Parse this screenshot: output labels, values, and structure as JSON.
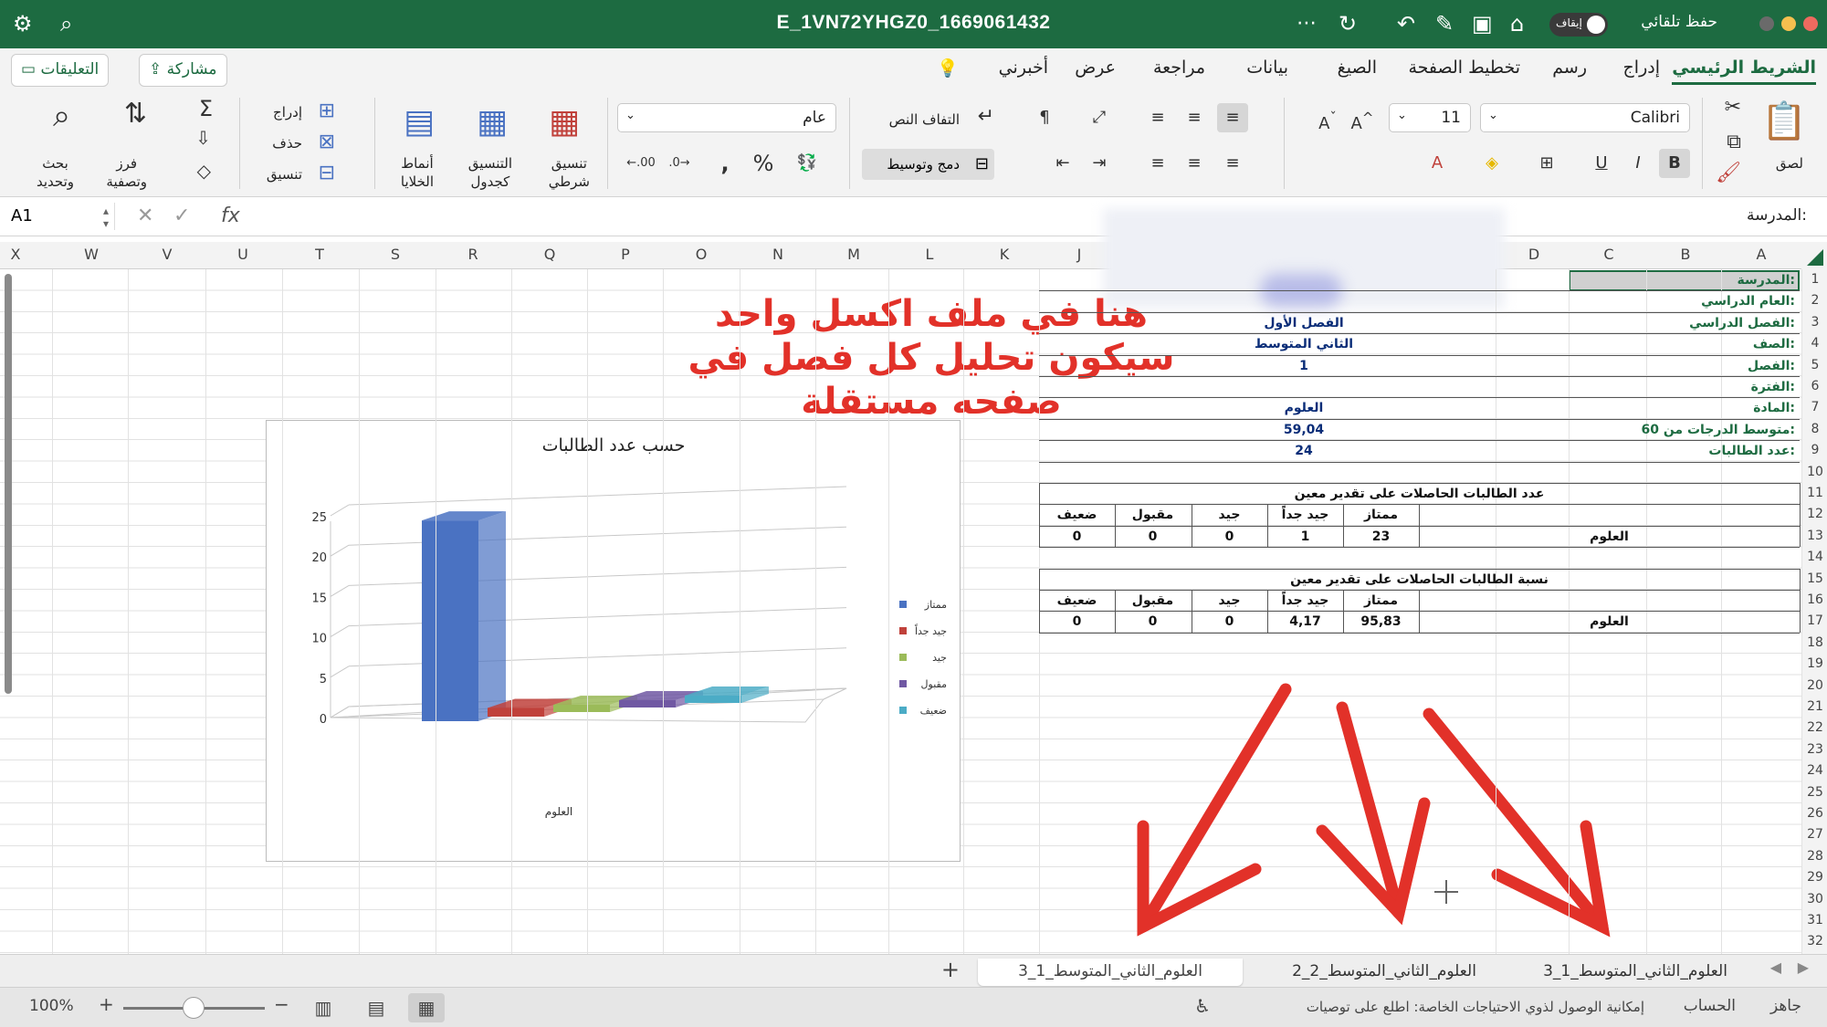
{
  "window": {
    "title": "E_1VN72YHGZ0_1669061432",
    "autosave_label": "حفظ تلقائي",
    "autosave_state": "إيقاف"
  },
  "ribbon_tabs": [
    "الشريط الرئيسي",
    "إدراج",
    "رسم",
    "تخطيط الصفحة",
    "الصيغ",
    "بيانات",
    "مراجعة",
    "عرض",
    "أخبرني"
  ],
  "share_label": "مشاركة",
  "comments_label": "التعليقات",
  "ribbon": {
    "paste": "لصق",
    "font_name": "Calibri",
    "font_size": "11",
    "wrap_text": "التفاف النص",
    "merge_center": "دمج وتوسيط",
    "number_format": "عام",
    "conditional_formatting": [
      "تنسيق",
      "شرطي"
    ],
    "format_as_table": [
      "التنسيق",
      "كجدول"
    ],
    "cell_styles": [
      "أنماط",
      "الخلايا"
    ],
    "insert": "إدراج",
    "delete": "حذف",
    "format": "تنسيق",
    "sort_filter": [
      "فرز",
      "وتصفية"
    ],
    "find_select": [
      "بحث",
      "وتحديد"
    ]
  },
  "formula_bar": {
    "name_box": "A1",
    "content": "المدرسة:"
  },
  "columns": [
    "A",
    "B",
    "C",
    "D",
    "J",
    "K",
    "L",
    "M",
    "N",
    "O",
    "P",
    "Q",
    "R",
    "S",
    "T",
    "U",
    "V",
    "W",
    "X"
  ],
  "rows": [
    "1",
    "2",
    "3",
    "4",
    "5",
    "6",
    "7",
    "8",
    "9",
    "10",
    "11",
    "12",
    "13",
    "14",
    "15",
    "16",
    "17",
    "18",
    "19",
    "20",
    "21",
    "22",
    "23",
    "24",
    "25",
    "26",
    "27",
    "28",
    "29",
    "30",
    "31",
    "32"
  ],
  "info_labels": [
    "المدرسة:",
    "العام الدراسي:",
    "الفصل الدراسي:",
    "الصف:",
    "الفصل:",
    "الفترة:",
    "المادة:",
    "متوسط الدرجات من 60:",
    "عدد الطالبات:"
  ],
  "info_values": [
    "",
    "",
    "الفصل الأول",
    "الثاني المتوسط",
    "1",
    "",
    "العلوم",
    "59,04",
    "24"
  ],
  "count_table": {
    "title": "عدد الطالبات الحاصلات على تقدير معين",
    "headers": [
      "ممتاز",
      "جيد جداً",
      "جيد",
      "مقبول",
      "ضعيف"
    ],
    "subject": "العلوم",
    "values": [
      "23",
      "1",
      "0",
      "0",
      "0"
    ]
  },
  "percent_table": {
    "title": "نسبة الطالبات الحاصلات على تقدير معين",
    "headers": [
      "ممتاز",
      "جيد جداً",
      "جيد",
      "مقبول",
      "ضعيف"
    ],
    "subject": "العلوم",
    "values": [
      "95,83",
      "4,17",
      "0",
      "0",
      "0"
    ]
  },
  "annotation": {
    "line1": "هنا في ملف اكسل واحد",
    "line2": "سيكون تحليل كل فصل في",
    "line3": "صفحه مستقلة",
    "color": "#e23129"
  },
  "chart_data": {
    "type": "bar",
    "title": "حسب عدد الطالبات",
    "categories": [
      "العلوم"
    ],
    "series": [
      {
        "name": "ممتاز",
        "values": [
          23
        ],
        "color": "#4a72c2"
      },
      {
        "name": "جيد جداً",
        "values": [
          1
        ],
        "color": "#c0413b"
      },
      {
        "name": "جيد",
        "values": [
          0
        ],
        "color": "#9bbb59"
      },
      {
        "name": "مقبول",
        "values": [
          0
        ],
        "color": "#7058a3"
      },
      {
        "name": "ضعيف",
        "values": [
          0
        ],
        "color": "#4bacc6"
      }
    ],
    "ylim": [
      0,
      25
    ],
    "yticks": [
      "0",
      "5",
      "10",
      "15",
      "20",
      "25"
    ],
    "legend": "right",
    "grid": true
  },
  "sheet_tabs": [
    "العلوم_الثاني_المتوسط_1_3",
    "العلوم_الثاني_المتوسط_2_2",
    "العلوم_الثاني_المتوسط_1_3"
  ],
  "status": {
    "ready": "جاهز",
    "account": "الحساب",
    "accessibility": "إمكانية الوصول لذوي الاحتياجات الخاصة: اطلع على توصيات",
    "zoom": "100%"
  }
}
